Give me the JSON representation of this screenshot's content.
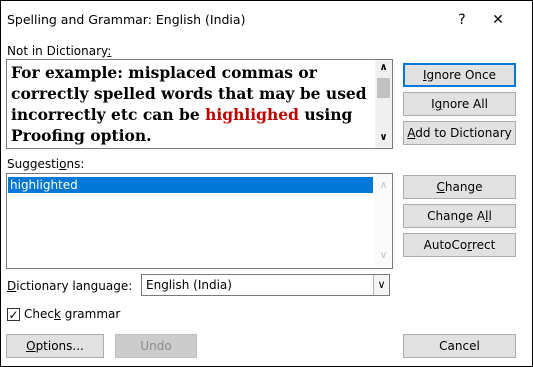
{
  "window": {
    "title": "Spelling and Grammar: English (India)",
    "help_glyph": "?",
    "close_glyph": "✕"
  },
  "not_in_dictionary": {
    "label_pre": "Not in Dictionary",
    "label_key": ":",
    "line1": "For example: misplaced commas or",
    "line2": "correctly spelled words that may be used",
    "line3_pre": "incorrectly etc can be ",
    "line3_error": "highlighed",
    "line3_post": " using",
    "line4": "Proofing option."
  },
  "suggestions": {
    "label_pre": "Suggesti",
    "label_key": "o",
    "label_post": "ns:",
    "items": [
      "highlighted"
    ]
  },
  "buttons": {
    "ignore_once": {
      "key": "I",
      "rest": "gnore Once"
    },
    "ignore_all": {
      "pre": "I",
      "key": "g",
      "rest": "nore All"
    },
    "add_to_dictionary": {
      "key": "A",
      "rest": "dd to Dictionary"
    },
    "change": {
      "key": "C",
      "rest": "hange"
    },
    "change_all": {
      "pre": "Change A",
      "key": "l",
      "rest": "l"
    },
    "autocorrect": {
      "pre": "AutoCo",
      "key": "r",
      "rest": "rect"
    },
    "options": {
      "key": "O",
      "rest": "ptions..."
    },
    "undo": "Undo",
    "cancel": "Cancel"
  },
  "dictionary_language": {
    "label_key": "D",
    "label_rest": "ictionary language:",
    "value": "English (India)"
  },
  "check_grammar": {
    "label_pre": "Chec",
    "label_key": "k",
    "label_post": " grammar",
    "checked": true,
    "check_glyph": "✓"
  },
  "scroll_glyphs": {
    "up": "∧",
    "down": "∨",
    "combo_down": "∨"
  }
}
